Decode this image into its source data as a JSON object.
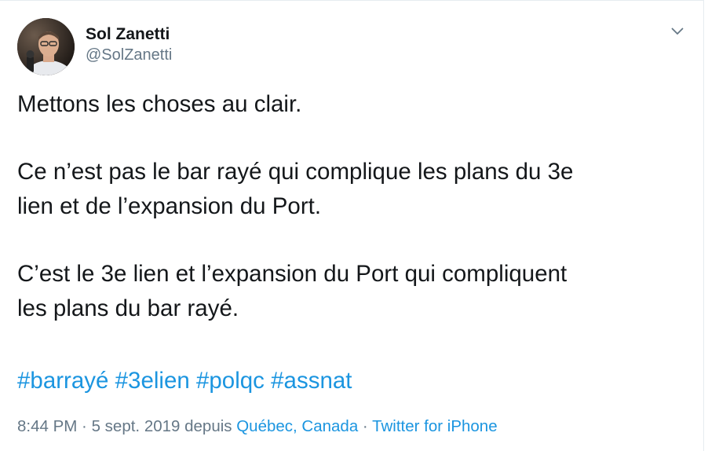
{
  "tweet": {
    "author": {
      "display_name": "Sol Zanetti",
      "handle": "@SolZanetti",
      "avatar_icon": "profile-photo"
    },
    "menu_icon": "chevron-down-icon",
    "paragraphs": [
      "Mettons les choses au clair.",
      "Ce n’est pas le bar rayé qui complique les plans du 3e\nlien et de l’expansion du Port.",
      "C’est le 3e lien et l’expansion du Port qui compliquent\nles plans du bar rayé."
    ],
    "hashtags": [
      "#barrayé",
      "#3elien",
      "#polqc",
      "#assnat"
    ],
    "meta": {
      "time": "8:44 PM",
      "sep1": " · ",
      "date_prefix": "5 sept. 2019 depuis ",
      "location": "Québec, Canada",
      "sep2": " · ",
      "source": "Twitter for iPhone"
    },
    "colors": {
      "link": "#1b95e0",
      "secondary": "#657786",
      "text": "#14171a"
    }
  }
}
